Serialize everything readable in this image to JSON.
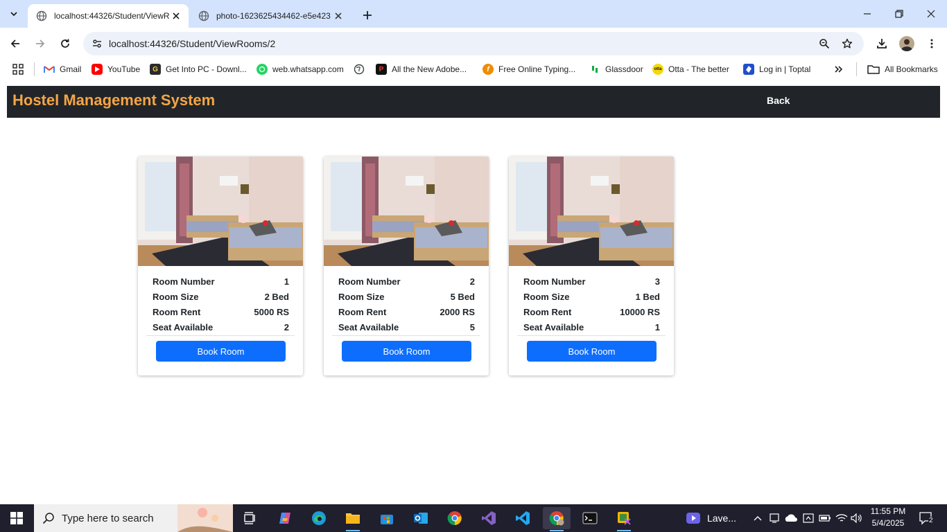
{
  "browser": {
    "tabs": [
      {
        "title": "localhost:44326/Student/ViewR"
      },
      {
        "title": "photo-1623625434462-e5e423"
      }
    ],
    "address": "localhost:44326/Student/ViewRooms/2",
    "bookmarks": [
      {
        "label": "Gmail",
        "icon": "gmail-icon",
        "color": "#ea4335"
      },
      {
        "label": "YouTube",
        "icon": "youtube-icon",
        "color": "#ff0000"
      },
      {
        "label": "Get Into PC - Downl...",
        "icon": "getintopc-icon",
        "color": "#2b2b2b"
      },
      {
        "label": "web.whatsapp.com",
        "icon": "whatsapp-icon",
        "color": "#25d366"
      },
      {
        "label": "All the New Adobe...",
        "icon": "adobe-icon",
        "color": "#111111"
      },
      {
        "label": "Free Online Typing...",
        "icon": "typing-icon",
        "color": "#f08c00"
      },
      {
        "label": "Glassdoor",
        "icon": "glassdoor-icon",
        "color": "#0caa41"
      },
      {
        "label": "Otta - The better",
        "icon": "otta-icon",
        "color": "#f5d90a"
      },
      {
        "label": "Log in | Toptal",
        "icon": "toptal-icon",
        "color": "#204ecf"
      }
    ],
    "all_bookmarks": "All Bookmarks"
  },
  "app": {
    "brand": "Hostel Management System",
    "back": "Back",
    "brand_color": "#f5a545"
  },
  "rooms": [
    {
      "number_label": "Room Number",
      "number": "1",
      "size_label": "Room Size",
      "size": "2 Bed",
      "rent_label": "Room Rent",
      "rent": "5000 RS",
      "seat_label": "Seat Available",
      "seat": "2",
      "button": "Book Room"
    },
    {
      "number_label": "Room Number",
      "number": "2",
      "size_label": "Room Size",
      "size": "5 Bed",
      "rent_label": "Room Rent",
      "rent": "2000 RS",
      "seat_label": "Seat Available",
      "seat": "5",
      "button": "Book Room"
    },
    {
      "number_label": "Room Number",
      "number": "3",
      "size_label": "Room Size",
      "size": "1 Bed",
      "rent_label": "Room Rent",
      "rent": "10000 RS",
      "seat_label": "Seat Available",
      "seat": "1",
      "button": "Book Room"
    }
  ],
  "taskbar": {
    "search_placeholder": "Type here to search",
    "media_label": "Lave...",
    "time": "11:55 PM",
    "date": "5/4/2025",
    "notification_count": "2"
  }
}
